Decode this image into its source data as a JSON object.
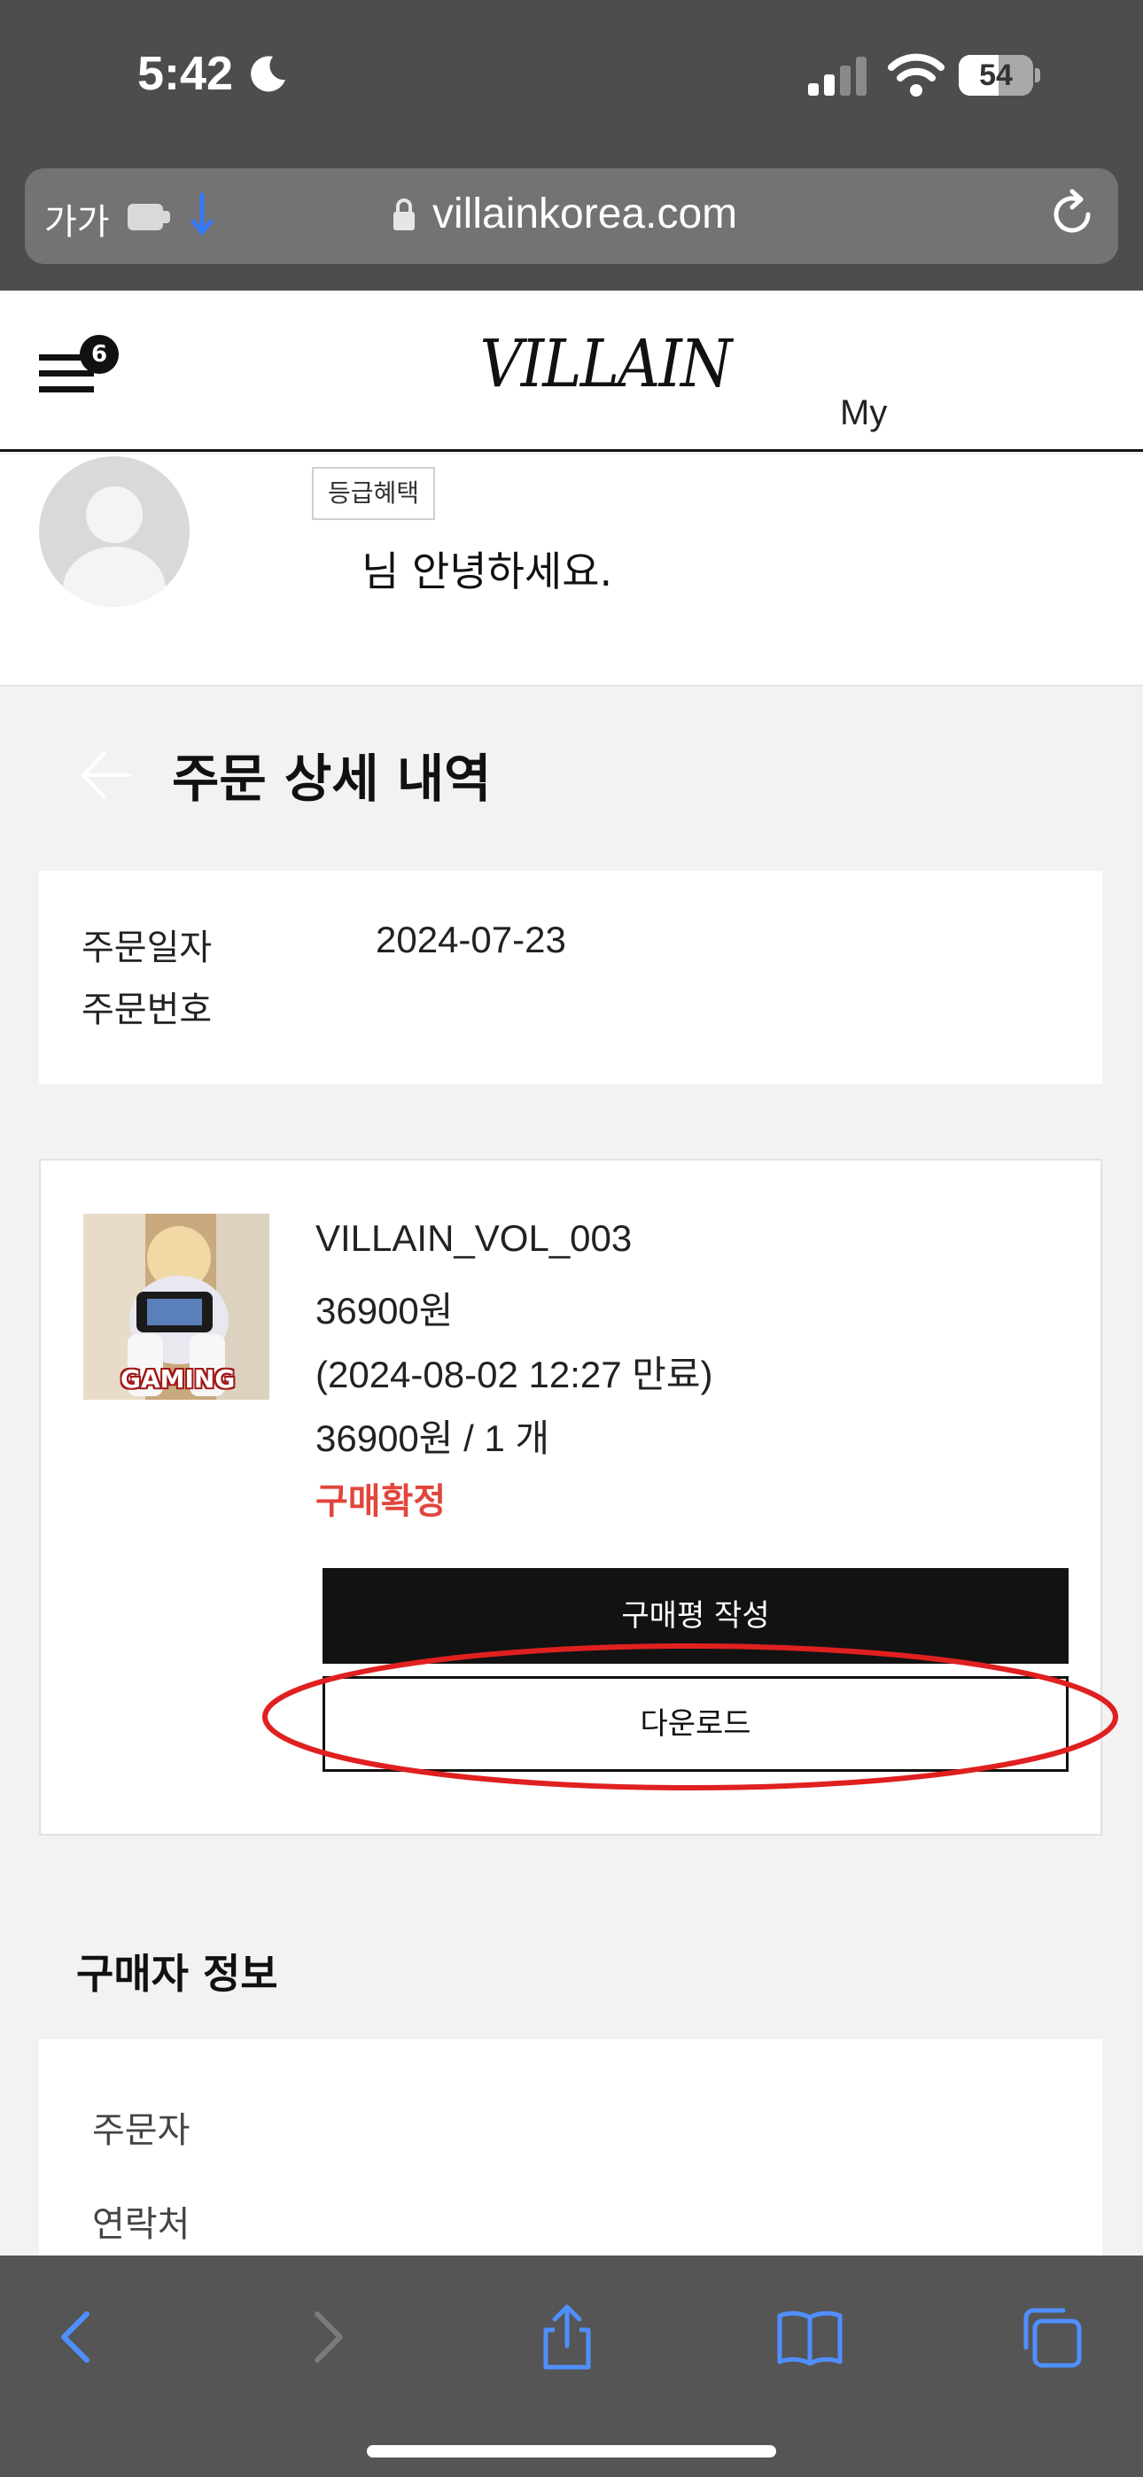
{
  "status_bar": {
    "time": "5:42",
    "battery_level": 54,
    "battery_text": "54"
  },
  "browser": {
    "text_size_label": "가가",
    "url": "villainkorea.com"
  },
  "header": {
    "menu_badge_count": "6",
    "logo": "VILLAIN",
    "my_link": "My"
  },
  "profile": {
    "grade_badge": "등급혜택",
    "greeting": "님 안녕하세요."
  },
  "page": {
    "title": "주문 상세 내역"
  },
  "order_info": {
    "date_label": "주문일자",
    "date_value": "2024-07-23",
    "number_label": "주문번호"
  },
  "product": {
    "thumbnail_caption": "GAMING",
    "name": "VILLAIN_VOL_003",
    "price": "36900원",
    "expiry": "(2024-08-02 12:27 만료)",
    "total_quantity": "36900원 / 1 개",
    "status": "구매확정",
    "review_button": "구매평 작성",
    "download_button": "다운로드"
  },
  "buyer": {
    "section_title": "구매자 정보",
    "orderer_label": "주문자",
    "contact_label": "연락처"
  },
  "colors": {
    "status_red": "#e0463c",
    "safari_blue": "#3478f6",
    "annotation_red": "#e02020"
  }
}
